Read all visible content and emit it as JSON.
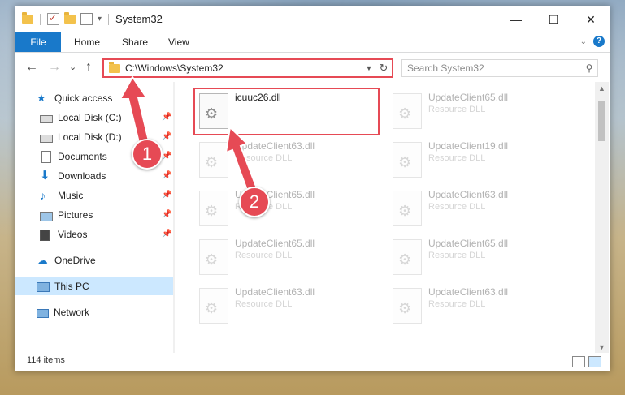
{
  "window": {
    "title": "System32",
    "controls": {
      "minimize": "—",
      "maximize": "☐",
      "close": "✕"
    }
  },
  "ribbon": {
    "tabs": [
      "File",
      "Home",
      "Share",
      "View"
    ],
    "help": "?"
  },
  "nav": {
    "back": "←",
    "forward": "→",
    "recent": "⌄",
    "up": "↑",
    "address": "C:\\Windows\\System32",
    "refresh": "↻",
    "search_placeholder": "Search System32",
    "search_icon": "⚲"
  },
  "sidebar": {
    "items": [
      {
        "label": "Quick access",
        "icon": "star-icon"
      },
      {
        "label": "Local Disk (C:)",
        "icon": "drive-icon",
        "pinned": true
      },
      {
        "label": "Local Disk (D:)",
        "icon": "drive-icon",
        "pinned": true
      },
      {
        "label": "Documents",
        "icon": "documents-icon",
        "pinned": true
      },
      {
        "label": "Downloads",
        "icon": "downloads-icon",
        "pinned": true
      },
      {
        "label": "Music",
        "icon": "music-icon",
        "pinned": true
      },
      {
        "label": "Pictures",
        "icon": "pictures-icon",
        "pinned": true
      },
      {
        "label": "Videos",
        "icon": "videos-icon",
        "pinned": true
      },
      {
        "label": "OneDrive",
        "icon": "cloud-icon"
      },
      {
        "label": "This PC",
        "icon": "pc-icon",
        "selected": true
      },
      {
        "label": "Network",
        "icon": "network-icon"
      }
    ]
  },
  "files": [
    {
      "name": "icuuc26.dll",
      "type": "",
      "highlighted": true
    },
    {
      "name": "UpdateClient65.dll",
      "type": "Resource DLL"
    },
    {
      "name": "UpdateClient63.dll",
      "type": "Resource DLL"
    },
    {
      "name": "UpdateClient19.dll",
      "type": "Resource DLL"
    },
    {
      "name": "UpdateClient65.dll",
      "type": "Resource DLL"
    },
    {
      "name": "UpdateClient63.dll",
      "type": "Resource DLL"
    },
    {
      "name": "UpdateClient65.dll",
      "type": "Resource DLL"
    },
    {
      "name": "UpdateClient65.dll",
      "type": "Resource DLL"
    },
    {
      "name": "UpdateClient63.dll",
      "type": "Resource DLL"
    },
    {
      "name": "UpdateClient63.dll",
      "type": "Resource DLL"
    }
  ],
  "status": {
    "item_count": "114 items"
  },
  "callouts": [
    "1",
    "2"
  ],
  "colors": {
    "accent": "#1979ca",
    "annotation": "#e64a55",
    "selection": "#cce8ff"
  }
}
